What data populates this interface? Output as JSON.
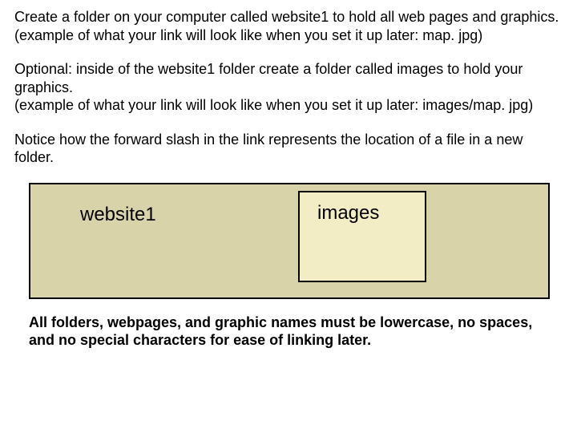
{
  "paragraphs": {
    "p1a": "Create a folder on your computer called website1 to hold all web pages and graphics.",
    "p1b": "(example of what your link will look like when you set it up later: map. jpg)",
    "p2a": "Optional: inside of the website1 folder create a folder called images to hold your graphics.",
    "p2b": "(example of what your link will look like when you set it up later: images/map. jpg)",
    "p3": "Notice how the forward slash in the link represents the location of a file in a new folder."
  },
  "folders": {
    "outer_label": "website1",
    "inner_label": "images"
  },
  "note": "All folders, webpages, and graphic names must be lowercase, no spaces, and no special characters for ease of linking later."
}
